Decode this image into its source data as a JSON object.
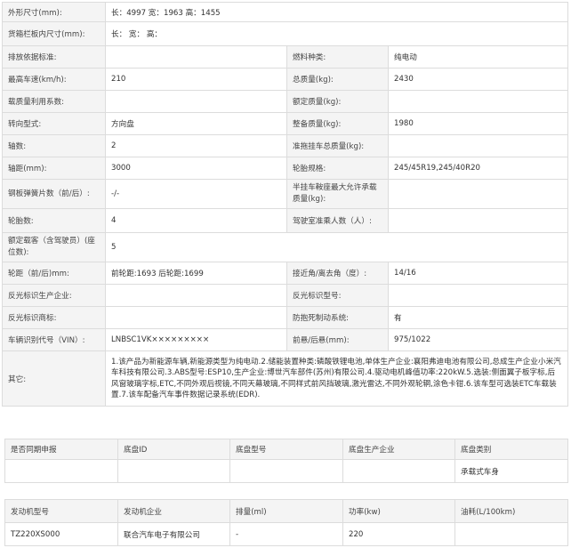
{
  "main": {
    "dimensions_label": "外形尺寸(mm):",
    "dimensions_value": "长：4997 宽：1963 高：1455",
    "cargo_label": "货箱栏板内尺寸(mm):",
    "cargo_value": "长：  宽：  高：",
    "emission_std_label": "排放依据标准:",
    "emission_std_value": "",
    "fuel_type_label": "燃料种类:",
    "fuel_type_value": "纯电动",
    "max_speed_label": "最高车速(km/h):",
    "max_speed_value": "210",
    "total_mass_label": "总质量(kg):",
    "total_mass_value": "2430",
    "load_util_label": "载质量利用系数:",
    "load_util_value": "",
    "rated_load_label": "额定质量(kg):",
    "rated_load_value": "",
    "steering_label": "转向型式:",
    "steering_value": "方向盘",
    "curb_mass_label": "整备质量(kg):",
    "curb_mass_value": "1980",
    "axles_label": "轴数:",
    "axles_value": "2",
    "trailer_mass_label": "准拖挂车总质量(kg):",
    "trailer_mass_value": "",
    "wheelbase_label": "轴距(mm):",
    "wheelbase_value": "3000",
    "tire_label": "轮胎规格:",
    "tire_value": "245/45R19,245/40R20",
    "leaf_spring_label": "钢板弹簧片数（前/后）:",
    "leaf_spring_value": "-/-",
    "saddle_label": "半挂车鞍座最大允许承载质量(kg):",
    "saddle_value": "",
    "tire_count_label": "轮胎数:",
    "tire_count_value": "4",
    "cab_passengers_label": "驾驶室准乘人数（人）:",
    "cab_passengers_value": "",
    "rated_passengers_label": "额定载客（含驾驶员）(座位数):",
    "rated_passengers_value": "5",
    "track_label": "轮距（前/后)mm:",
    "track_value": "前轮距:1693 后轮距:1699",
    "angles_label": "接近角/离去角（度）:",
    "angles_value": "14/16",
    "reflector_maker_label": "反光标识生产企业:",
    "reflector_maker_value": "",
    "reflector_model_label": "反光标识型号:",
    "reflector_model_value": "",
    "reflector_brand_label": "反光标识商标:",
    "reflector_brand_value": "",
    "abs_label": "防抱死制动系统:",
    "abs_value": "有",
    "vin_label": "车辆识别代号（VIN）:",
    "vin_value": "LNBSC1VK×××××××××",
    "overhang_label": "前悬/后悬(mm):",
    "overhang_value": "975/1022",
    "other_label": "其它:",
    "other_value": "1.该产品为新能源车辆,新能源类型为纯电动.2.储能装置种类:磷酸铁锂电池,单体生产企业:襄阳弗迪电池有限公司,总成生产企业小米汽车科技有限公司.3.ABS型号:ESP10,生产企业:博世汽车部件(苏州)有限公司.4.驱动电机峰值功率:220kW.5.选装:侧面翼子板字标,后风窗玻璃字标,ETC,不同外观后视镜,不同天幕玻璃,不同样式前风挡玻璃,激光雷达,不同外观轮辋,涂色卡钳.6.该车型可选装ETC车载装置.7.该车配备汽车事件数据记录系统(EDR)."
  },
  "chassis": {
    "headers": [
      "是否同期申报",
      "底盘ID",
      "底盘型号",
      "底盘生产企业",
      "底盘类别"
    ],
    "row": [
      "",
      "",
      "",
      "",
      "承载式车身"
    ]
  },
  "engine": {
    "headers": [
      "发动机型号",
      "发动机企业",
      "排量(ml)",
      "功率(kw)",
      "油耗(L/100km)"
    ],
    "row": [
      "TZ220XS000",
      "联合汽车电子有限公司",
      "-",
      "220",
      ""
    ]
  }
}
